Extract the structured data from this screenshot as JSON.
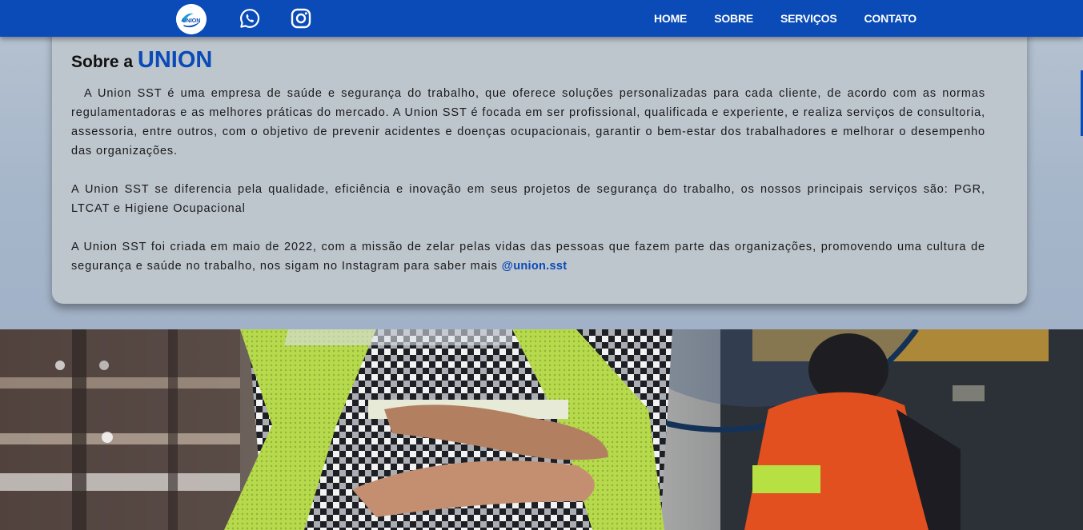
{
  "navbar": {
    "logo_text": "UNION",
    "links": [
      {
        "label": "HOME"
      },
      {
        "label": "SOBRE"
      },
      {
        "label": "SERVIÇOS"
      },
      {
        "label": "CONTATO"
      }
    ]
  },
  "about": {
    "title_prefix": "Sobre a",
    "title_brand": "UNION",
    "paragraphs": [
      "A Union SST é uma empresa de saúde e segurança do trabalho, que oferece soluções personalizadas para cada cliente, de acordo com as normas regulamentadoras e as melhores práticas do mercado. A Union SST é focada em ser profissional, qualificada e experiente, e realiza serviços de consultoria, assessoria, entre outros, com o objetivo de prevenir acidentes e doenças ocupacionais, garantir o bem-estar dos trabalhadores e melhorar o desempenho das organizações.",
      "A Union SST se diferencia pela qualidade, eficiência e inovação em seus projetos de segurança do trabalho, os nossos principais serviços são: PGR, LTCAT e Higiene Ocupacional"
    ],
    "last_paragraph": "A Union SST foi criada em maio de 2022, com a missão de zelar pelas vidas das pessoas que fazem parte das organizações, promovendo uma cultura de segurança e saúde no trabalho, nos sigam no Instagram para saber mais",
    "instagram_handle": "@union.sst"
  },
  "colors": {
    "primary": "#0a4bb7",
    "card_background": "#bdc5cd",
    "page_background": "#a3b3c7"
  },
  "icons": {
    "whatsapp": "whatsapp-icon",
    "instagram": "instagram-icon"
  }
}
